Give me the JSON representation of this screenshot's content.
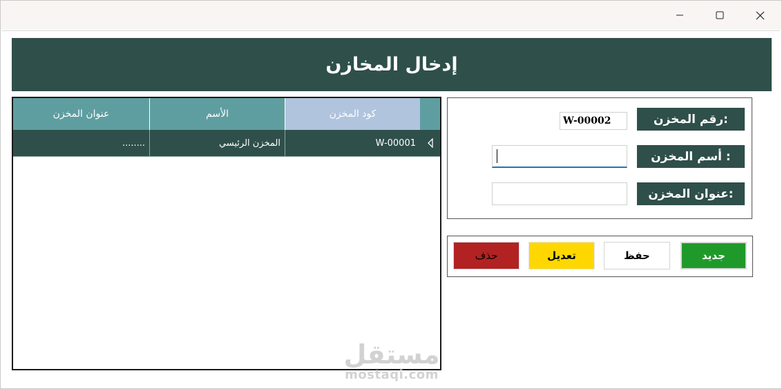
{
  "window": {
    "controls": {
      "minimize_icon": "minimize-icon",
      "maximize_icon": "maximize-icon",
      "close_icon": "close-icon"
    }
  },
  "header": {
    "title": "إدخال المخازن"
  },
  "grid": {
    "columns": [
      "كود المخزن",
      "الأسم",
      "عنوان المخزن"
    ],
    "rows": [
      {
        "code": "W-00001",
        "name": "المخزن الرئيسي",
        "address": "........"
      }
    ],
    "current_row_icon": "row-pointer-icon"
  },
  "form": {
    "number_label": "رقم المخزن:",
    "number_value": "W-00002",
    "name_label": "أسم المخزن :",
    "name_value": "",
    "address_label": "عنوان المخزن:",
    "address_value": ""
  },
  "buttons": {
    "new": "جديد",
    "save": "حفظ",
    "edit": "تعديل",
    "delete": "حذف"
  },
  "colors": {
    "header_bg": "#2f4f4a",
    "grid_header": "#5f9ea0",
    "selected_column": "#b0c4de",
    "new_button": "#1f9a2a",
    "edit_button": "#ffd700",
    "delete_button": "#b22222"
  },
  "watermark": {
    "arabic": "مستقل",
    "latin": "mostaqi.com"
  }
}
